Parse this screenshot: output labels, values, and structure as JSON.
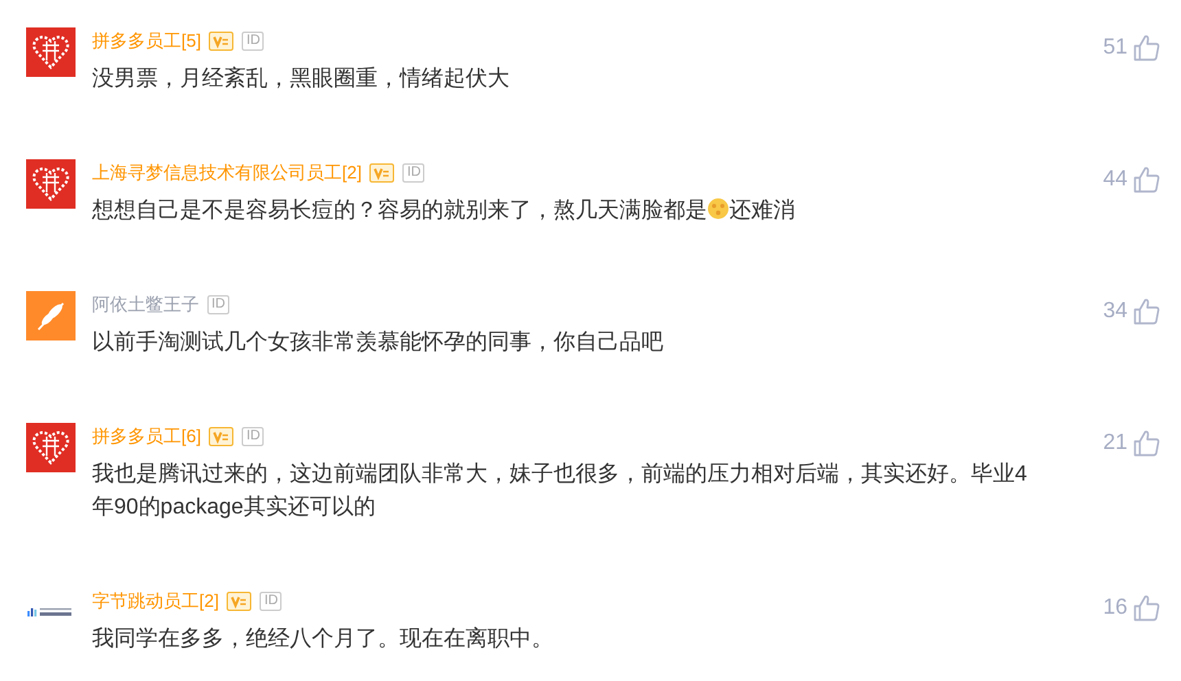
{
  "comments": [
    {
      "avatar": {
        "kind": "heart"
      },
      "author": "拼多多员工[5]",
      "employee": true,
      "vip_badge": true,
      "id_badge": "ID",
      "text": "没男票，月经紊乱，黑眼圈重，情绪起伏大",
      "likes": "51"
    },
    {
      "avatar": {
        "kind": "heart"
      },
      "author": "上海寻梦信息技术有限公司员工[2]",
      "employee": true,
      "vip_badge": true,
      "id_badge": "ID",
      "text": "想想自己是不是容易长痘的？容易的就别来了，熬几天满脸都是",
      "emoji": true,
      "text_after": "还难消",
      "likes": "44"
    },
    {
      "avatar": {
        "kind": "wheat"
      },
      "author": "阿依土鳖王子",
      "employee": false,
      "vip_badge": false,
      "id_badge": "ID",
      "text": "以前手淘测试几个女孩非常羡慕能怀孕的同事，你自己品吧",
      "likes": "34"
    },
    {
      "avatar": {
        "kind": "heart"
      },
      "author": "拼多多员工[6]",
      "employee": true,
      "vip_badge": true,
      "id_badge": "ID",
      "text": "我也是腾讯过来的，这边前端团队非常大，妹子也很多，前端的压力相对后端，其实还好。毕业4年90的package其实还可以的",
      "likes": "21"
    },
    {
      "avatar": {
        "kind": "bars"
      },
      "author": "字节跳动员工[2]",
      "employee": true,
      "vip_badge": true,
      "id_badge": "ID",
      "text": "我同学在多多，绝经八个月了。现在在离职中。",
      "likes": "16"
    }
  ]
}
